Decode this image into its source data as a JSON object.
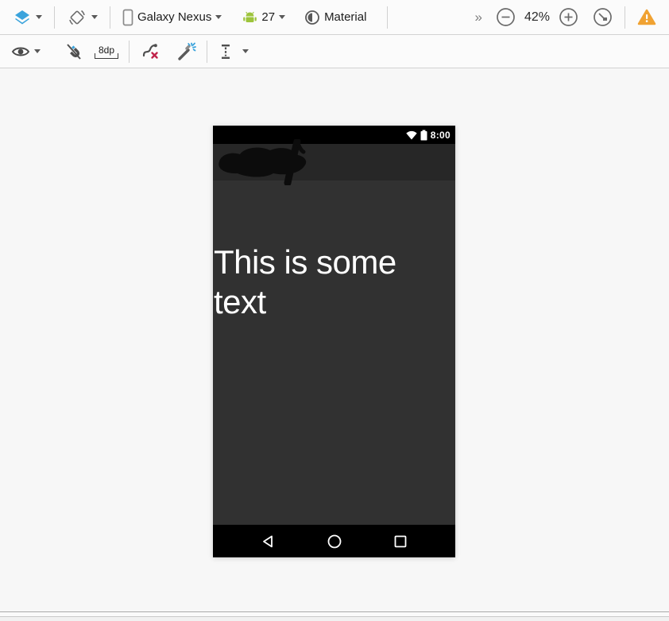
{
  "design_toolbar": {
    "device": "Galaxy Nexus",
    "api_level": "27",
    "theme": "Material",
    "overflow": "»",
    "zoom_level": "42%"
  },
  "constraint_toolbar": {
    "default_margin": "8dp"
  },
  "phone_preview": {
    "status_time": "8:00",
    "body_text": "This is some text"
  },
  "colors": {
    "accent_blue": "#3aa3dc",
    "android_green": "#9dc43b",
    "warning_orange": "#f0a232",
    "error_red": "#c0234a",
    "phone_status_bar": "#000000",
    "phone_action_bar": "#272727",
    "phone_background": "#313131",
    "phone_text": "#ffffff"
  },
  "icons": {
    "design-surface-icon": "blue stacked layers",
    "orientation-icon": "rotated square with arrows",
    "device-icon": "phone outline",
    "android-icon": "green robot",
    "theme-icon": "half-filled contrast circle",
    "overflow-icon": "double chevron right",
    "zoom-out-icon": "minus in circle",
    "zoom-in-icon": "plus in circle",
    "zoom-fit-icon": "fit-to-screen circle",
    "warning-icon": "orange exclamation triangle",
    "view-options-icon": "eye",
    "autoconnect-off-icon": "magnet with slash",
    "clear-constraints-icon": "curved path with red x",
    "infer-constraints-icon": "magic wand with sparks",
    "pack-icon": "vertical distribute I-beam",
    "wifi-icon": "wifi wedge",
    "battery-icon": "battery",
    "back-icon": "left triangle outline",
    "home-icon": "circle outline",
    "recents-icon": "square outline",
    "redaction-scribble": "black marker scribble"
  }
}
